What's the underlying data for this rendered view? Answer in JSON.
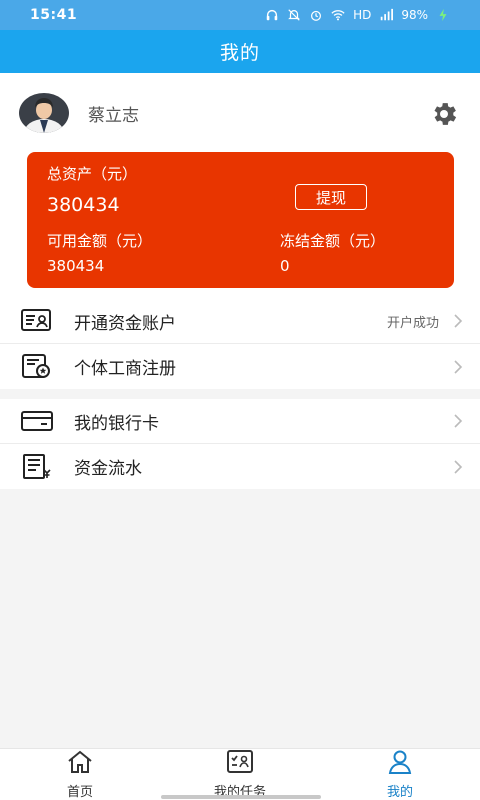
{
  "status_bar": {
    "time": "15:41",
    "network": "HD",
    "signal": "4G",
    "battery": "98%"
  },
  "title": "我的",
  "profile": {
    "name": "蔡立志",
    "avatar_icon": "user-avatar-icon",
    "settings_icon": "gear-icon"
  },
  "assets": {
    "total_label": "总资产（元）",
    "total_value": "380434",
    "withdraw_label": "提现",
    "available_label": "可用金额（元）",
    "available_value": "380434",
    "frozen_label": "冻结金额（元）",
    "frozen_value": "0",
    "card_color": "#e83500"
  },
  "menu_group_1": [
    {
      "label": "开通资金账户",
      "status": "开户成功",
      "icon": "account-card-icon"
    },
    {
      "label": "个体工商注册",
      "status": "",
      "icon": "business-license-icon"
    }
  ],
  "menu_group_2": [
    {
      "label": "我的银行卡",
      "status": "",
      "icon": "bank-card-icon"
    },
    {
      "label": "资金流水",
      "status": "",
      "icon": "transaction-record-icon"
    }
  ],
  "bottom_nav": [
    {
      "label": "首页",
      "icon": "home-icon",
      "active": false
    },
    {
      "label": "我的任务",
      "icon": "task-icon",
      "active": false
    },
    {
      "label": "我的",
      "icon": "profile-icon",
      "active": true
    }
  ],
  "colors": {
    "title_bar": "#1ba5ee",
    "active_nav": "#1a82c8"
  }
}
